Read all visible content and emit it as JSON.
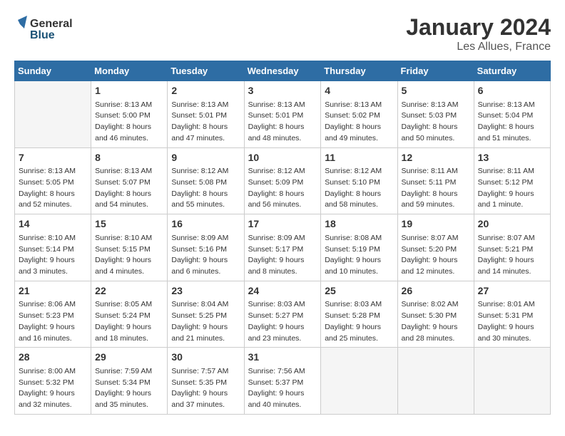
{
  "header": {
    "logo_general": "General",
    "logo_blue": "Blue",
    "title": "January 2024",
    "subtitle": "Les Allues, France"
  },
  "calendar": {
    "days_of_week": [
      "Sunday",
      "Monday",
      "Tuesday",
      "Wednesday",
      "Thursday",
      "Friday",
      "Saturday"
    ],
    "weeks": [
      [
        {
          "day": "",
          "info": ""
        },
        {
          "day": "1",
          "info": "Sunrise: 8:13 AM\nSunset: 5:00 PM\nDaylight: 8 hours\nand 46 minutes."
        },
        {
          "day": "2",
          "info": "Sunrise: 8:13 AM\nSunset: 5:01 PM\nDaylight: 8 hours\nand 47 minutes."
        },
        {
          "day": "3",
          "info": "Sunrise: 8:13 AM\nSunset: 5:01 PM\nDaylight: 8 hours\nand 48 minutes."
        },
        {
          "day": "4",
          "info": "Sunrise: 8:13 AM\nSunset: 5:02 PM\nDaylight: 8 hours\nand 49 minutes."
        },
        {
          "day": "5",
          "info": "Sunrise: 8:13 AM\nSunset: 5:03 PM\nDaylight: 8 hours\nand 50 minutes."
        },
        {
          "day": "6",
          "info": "Sunrise: 8:13 AM\nSunset: 5:04 PM\nDaylight: 8 hours\nand 51 minutes."
        }
      ],
      [
        {
          "day": "7",
          "info": "Sunrise: 8:13 AM\nSunset: 5:05 PM\nDaylight: 8 hours\nand 52 minutes."
        },
        {
          "day": "8",
          "info": "Sunrise: 8:13 AM\nSunset: 5:07 PM\nDaylight: 8 hours\nand 54 minutes."
        },
        {
          "day": "9",
          "info": "Sunrise: 8:12 AM\nSunset: 5:08 PM\nDaylight: 8 hours\nand 55 minutes."
        },
        {
          "day": "10",
          "info": "Sunrise: 8:12 AM\nSunset: 5:09 PM\nDaylight: 8 hours\nand 56 minutes."
        },
        {
          "day": "11",
          "info": "Sunrise: 8:12 AM\nSunset: 5:10 PM\nDaylight: 8 hours\nand 58 minutes."
        },
        {
          "day": "12",
          "info": "Sunrise: 8:11 AM\nSunset: 5:11 PM\nDaylight: 8 hours\nand 59 minutes."
        },
        {
          "day": "13",
          "info": "Sunrise: 8:11 AM\nSunset: 5:12 PM\nDaylight: 9 hours\nand 1 minute."
        }
      ],
      [
        {
          "day": "14",
          "info": "Sunrise: 8:10 AM\nSunset: 5:14 PM\nDaylight: 9 hours\nand 3 minutes."
        },
        {
          "day": "15",
          "info": "Sunrise: 8:10 AM\nSunset: 5:15 PM\nDaylight: 9 hours\nand 4 minutes."
        },
        {
          "day": "16",
          "info": "Sunrise: 8:09 AM\nSunset: 5:16 PM\nDaylight: 9 hours\nand 6 minutes."
        },
        {
          "day": "17",
          "info": "Sunrise: 8:09 AM\nSunset: 5:17 PM\nDaylight: 9 hours\nand 8 minutes."
        },
        {
          "day": "18",
          "info": "Sunrise: 8:08 AM\nSunset: 5:19 PM\nDaylight: 9 hours\nand 10 minutes."
        },
        {
          "day": "19",
          "info": "Sunrise: 8:07 AM\nSunset: 5:20 PM\nDaylight: 9 hours\nand 12 minutes."
        },
        {
          "day": "20",
          "info": "Sunrise: 8:07 AM\nSunset: 5:21 PM\nDaylight: 9 hours\nand 14 minutes."
        }
      ],
      [
        {
          "day": "21",
          "info": "Sunrise: 8:06 AM\nSunset: 5:23 PM\nDaylight: 9 hours\nand 16 minutes."
        },
        {
          "day": "22",
          "info": "Sunrise: 8:05 AM\nSunset: 5:24 PM\nDaylight: 9 hours\nand 18 minutes."
        },
        {
          "day": "23",
          "info": "Sunrise: 8:04 AM\nSunset: 5:25 PM\nDaylight: 9 hours\nand 21 minutes."
        },
        {
          "day": "24",
          "info": "Sunrise: 8:03 AM\nSunset: 5:27 PM\nDaylight: 9 hours\nand 23 minutes."
        },
        {
          "day": "25",
          "info": "Sunrise: 8:03 AM\nSunset: 5:28 PM\nDaylight: 9 hours\nand 25 minutes."
        },
        {
          "day": "26",
          "info": "Sunrise: 8:02 AM\nSunset: 5:30 PM\nDaylight: 9 hours\nand 28 minutes."
        },
        {
          "day": "27",
          "info": "Sunrise: 8:01 AM\nSunset: 5:31 PM\nDaylight: 9 hours\nand 30 minutes."
        }
      ],
      [
        {
          "day": "28",
          "info": "Sunrise: 8:00 AM\nSunset: 5:32 PM\nDaylight: 9 hours\nand 32 minutes."
        },
        {
          "day": "29",
          "info": "Sunrise: 7:59 AM\nSunset: 5:34 PM\nDaylight: 9 hours\nand 35 minutes."
        },
        {
          "day": "30",
          "info": "Sunrise: 7:57 AM\nSunset: 5:35 PM\nDaylight: 9 hours\nand 37 minutes."
        },
        {
          "day": "31",
          "info": "Sunrise: 7:56 AM\nSunset: 5:37 PM\nDaylight: 9 hours\nand 40 minutes."
        },
        {
          "day": "",
          "info": ""
        },
        {
          "day": "",
          "info": ""
        },
        {
          "day": "",
          "info": ""
        }
      ]
    ]
  }
}
